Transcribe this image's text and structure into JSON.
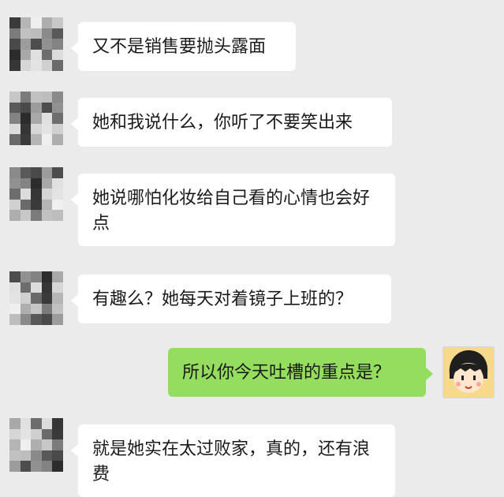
{
  "chat": {
    "messages": [
      {
        "from": "other",
        "text": "又不是销售要抛头露面"
      },
      {
        "from": "other",
        "text": "她和我说什么，你听了不要笑出来"
      },
      {
        "from": "other",
        "text": "她说哪怕化妆给自己看的心情也会好点"
      },
      {
        "from": "other",
        "text": "有趣么？她每天对着镜子上班的？"
      },
      {
        "from": "self",
        "text": "所以你今天吐槽的重点是？"
      },
      {
        "from": "other",
        "text": "就是她实在太过败家，真的，还有浪费"
      }
    ]
  },
  "colors": {
    "background": "#ebebeb",
    "incoming_bubble": "#ffffff",
    "outgoing_bubble": "#95dd5f",
    "text": "#1a1a1a"
  },
  "icons": {
    "contact_avatar": "pixelated-avatar-icon",
    "self_avatar": "cartoon-girl-avatar-icon"
  }
}
